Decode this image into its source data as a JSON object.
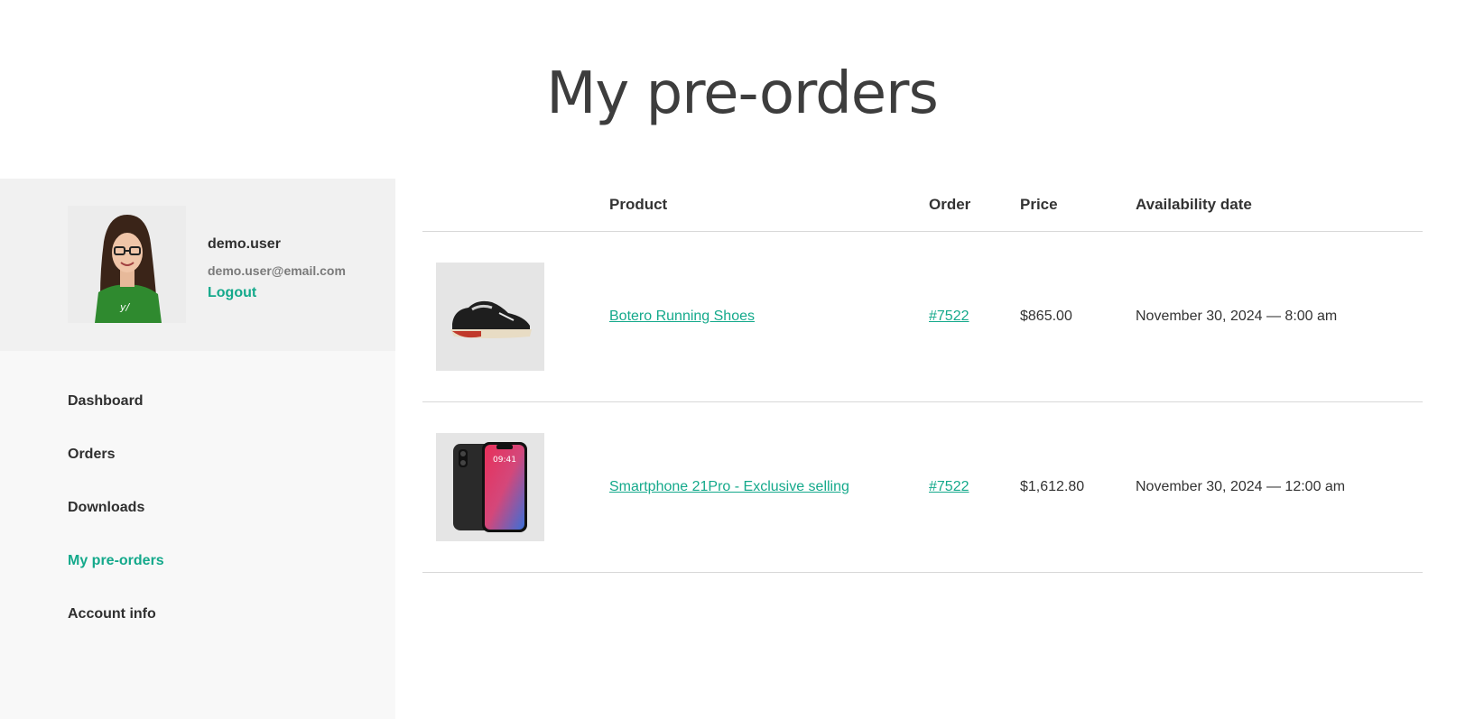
{
  "page": {
    "title": "My pre-orders"
  },
  "profile": {
    "username": "demo.user",
    "email": "demo.user@email.com",
    "logout_label": "Logout"
  },
  "nav": {
    "items": [
      {
        "label": "Dashboard"
      },
      {
        "label": "Orders"
      },
      {
        "label": "Downloads"
      },
      {
        "label": "My pre-orders",
        "active": true
      },
      {
        "label": "Account info"
      }
    ]
  },
  "table": {
    "headers": {
      "image": "",
      "product": "Product",
      "order": "Order",
      "price": "Price",
      "availability": "Availability date"
    },
    "rows": [
      {
        "product": "Botero Running Shoes",
        "order": "#7522",
        "price": "$865.00",
        "availability": "November 30, 2024 — 8:00 am",
        "image_icon": "sneaker-image"
      },
      {
        "product": "Smartphone 21Pro - Exclusive selling",
        "order": "#7522",
        "price": "$1,612.80",
        "availability": "November 30, 2024 — 12:00 am",
        "image_icon": "smartphone-image",
        "phone_time": "09:41"
      }
    ]
  },
  "colors": {
    "accent": "#14a98b",
    "text": "#333333",
    "sidebar_bg": "#f8f8f8",
    "profile_bg": "#f1f1f1"
  }
}
